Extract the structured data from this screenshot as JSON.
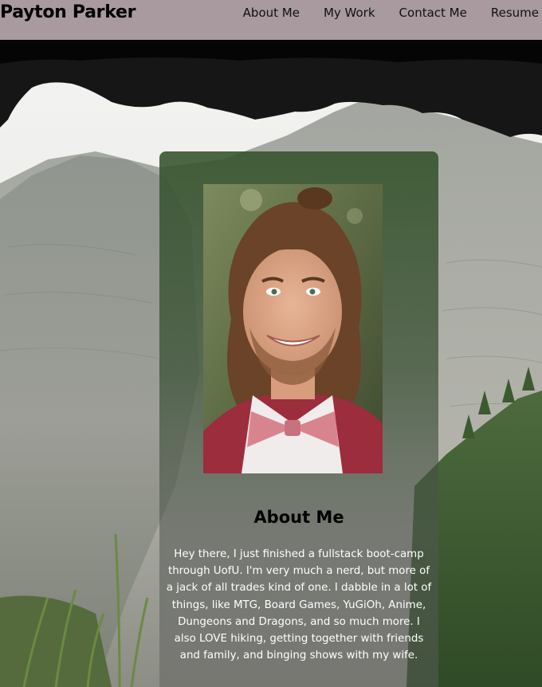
{
  "nav": {
    "brand": "Payton Parker",
    "links": [
      {
        "label": "About Me"
      },
      {
        "label": "My Work"
      },
      {
        "label": "Contact Me"
      },
      {
        "label": "Resume"
      }
    ]
  },
  "about": {
    "title": "About Me",
    "lines": [
      "Hey there, I just finished a fullstack boot-camp",
      "through UofU. I'm very much a nerd, but more of",
      "a jack of all trades kind of one. I dabble in a lot of",
      "things, like MTG, Board Games, YuGiOh, Anime,",
      "Dungeons and Dragons, and so much more. I",
      "also LOVE hiking, getting together with friends",
      "and family, and binging shows with my wife."
    ]
  },
  "colors": {
    "nav_bg": "#a89a9f",
    "card_top": "#34522a",
    "text_light": "#ffffff",
    "text_dark": "#000000"
  }
}
